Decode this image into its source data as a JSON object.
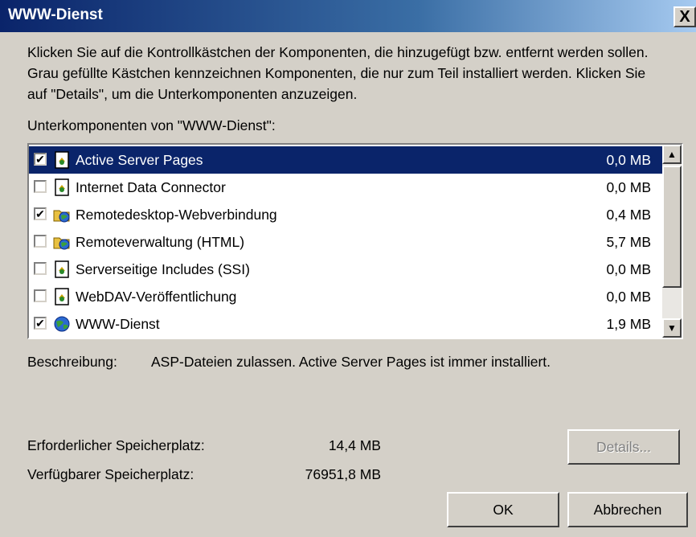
{
  "window": {
    "title": "WWW-Dienst",
    "close_label": "X"
  },
  "intro_text": "Klicken Sie auf die Kontrollkästchen der Komponenten, die hinzugefügt bzw. entfernt werden sollen. Grau gefüllte Kästchen kennzeichnen Komponenten, die nur zum Teil installiert werden. Klicken Sie auf \"Details\", um die Unterkomponenten anzuzeigen.",
  "list_label": "Unterkomponenten von \"WWW-Dienst\":",
  "components": [
    {
      "label": "Active Server Pages",
      "size": "0,0 MB",
      "checked": true,
      "selected": true,
      "icon": "document-icon"
    },
    {
      "label": "Internet Data Connector",
      "size": "0,0 MB",
      "checked": false,
      "selected": false,
      "icon": "document-icon"
    },
    {
      "label": "Remotedesktop-Webverbindung",
      "size": "0,4 MB",
      "checked": true,
      "selected": false,
      "icon": "folder-globe-icon"
    },
    {
      "label": "Remoteverwaltung (HTML)",
      "size": "5,7 MB",
      "checked": false,
      "selected": false,
      "icon": "folder-globe-icon"
    },
    {
      "label": "Serverseitige Includes (SSI)",
      "size": "0,0 MB",
      "checked": false,
      "selected": false,
      "icon": "document-icon"
    },
    {
      "label": "WebDAV-Veröffentlichung",
      "size": "0,0 MB",
      "checked": false,
      "selected": false,
      "icon": "document-icon"
    },
    {
      "label": "WWW-Dienst",
      "size": "1,9 MB",
      "checked": true,
      "selected": false,
      "icon": "globe-icon"
    }
  ],
  "description": {
    "label": "Beschreibung:",
    "text": "ASP-Dateien zulassen. Active Server Pages ist immer installiert."
  },
  "space": {
    "required_label": "Erforderlicher Speicherplatz:",
    "required_value": "14,4 MB",
    "available_label": "Verfügbarer Speicherplatz:",
    "available_value": "76951,8 MB"
  },
  "buttons": {
    "details": "Details...",
    "ok": "OK",
    "cancel": "Abbrechen"
  },
  "colors": {
    "title_start": "#0a246a",
    "title_end": "#a6caf0",
    "face": "#d4d0c8",
    "selection": "#0a246a"
  }
}
